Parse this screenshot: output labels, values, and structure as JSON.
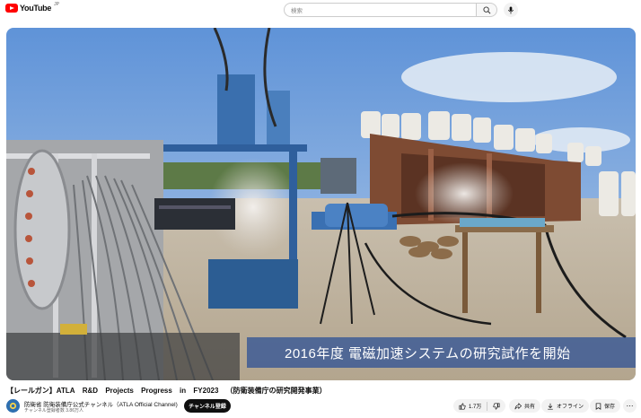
{
  "header": {
    "logo_text": "YouTube",
    "logo_region": "JP",
    "search_placeholder": "検索",
    "search_icon": "search-icon",
    "mic_icon": "mic-icon"
  },
  "video": {
    "caption": "2016年度 電磁加速システムの研究試作を開始",
    "title_parts": [
      "【レールガン】ATLA",
      "R&D",
      "Projects",
      "Progress",
      "in",
      "FY2023",
      "（防衛装備庁の研究開発事業）"
    ]
  },
  "channel": {
    "name": "防衛省 防衛装備庁公式チャンネル（ATLA Official Channel)",
    "subscribers": "チャンネル登録者数 3.86万人",
    "subscribe_label": "チャンネル登録"
  },
  "actions": {
    "like_count": "1.7万",
    "share_label": "共有",
    "offline_label": "オフライン",
    "save_label": "保存"
  },
  "colors": {
    "brand": "#ff0000",
    "subscribe_bg": "#0f0f0f",
    "caption_band": "#284e96"
  }
}
